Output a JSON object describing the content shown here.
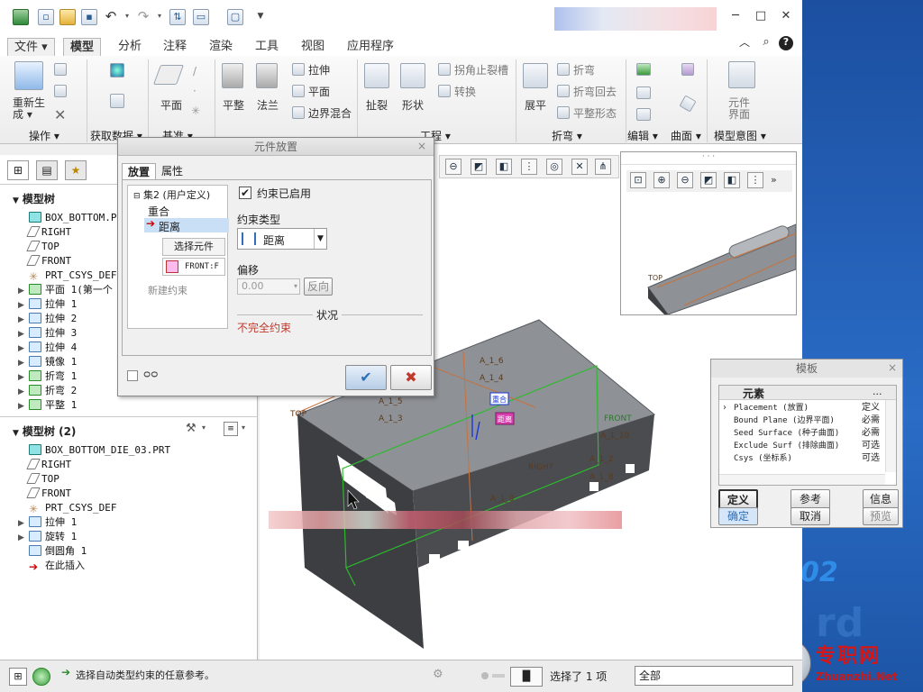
{
  "desktop": {
    "version_text": "02",
    "watermark_text": "rd",
    "site_name": "专职网",
    "site_url": "Zhuanzhi.Net"
  },
  "titlebar": {
    "min": "─",
    "max": "□",
    "close": "✕"
  },
  "ribbon_tabs": [
    "文件 ▾",
    "模型",
    "分析",
    "注释",
    "渲染",
    "工具",
    "视图",
    "应用程序"
  ],
  "ribbon": {
    "regen_label": "重新生成 ▾",
    "buttons": {
      "plane": "平面",
      "flatten": "平整",
      "method": "法兰",
      "extrude": "拉伸",
      "flat": "平面",
      "boundary_blend": "边界混合",
      "rip": "扯裂",
      "form": "形状",
      "corner_relief": "拐角止裂槽",
      "convert": "转换",
      "unbend": "展平",
      "bend": "折弯",
      "bend_back": "折弯回去",
      "flat_pattern": "平整形态",
      "component_interface": "元件界面"
    },
    "groups": [
      "操作 ▾",
      "获取数据 ▾",
      "基准 ▾",
      "工程 ▾",
      "折弯 ▾",
      "编辑 ▾",
      "曲面 ▾",
      "模型意图 ▾"
    ]
  },
  "left_panel": {
    "tree1_title": "模型树",
    "tree1": [
      {
        "icon": "part",
        "label": "BOX_BOTTOM.PRT",
        "toggle": ""
      },
      {
        "icon": "plane",
        "label": "RIGHT",
        "toggle": ""
      },
      {
        "icon": "plane",
        "label": "TOP",
        "toggle": ""
      },
      {
        "icon": "plane",
        "label": "FRONT",
        "toggle": ""
      },
      {
        "icon": "csys",
        "label": "PRT_CSYS_DEF",
        "toggle": ""
      },
      {
        "icon": "green",
        "label": "平面 1(第一个",
        "toggle": "▶"
      },
      {
        "icon": "blue",
        "label": "拉伸 1",
        "toggle": "▶"
      },
      {
        "icon": "blue",
        "label": "拉伸 2",
        "toggle": "▶"
      },
      {
        "icon": "blue",
        "label": "拉伸 3",
        "toggle": "▶"
      },
      {
        "icon": "blue",
        "label": "拉伸 4",
        "toggle": "▶"
      },
      {
        "icon": "blue",
        "label": "镜像 1",
        "toggle": "▶"
      },
      {
        "icon": "green",
        "label": "折弯 1",
        "toggle": "▶"
      },
      {
        "icon": "green",
        "label": "折弯 2",
        "toggle": "▶"
      },
      {
        "icon": "green",
        "label": "平整 1",
        "toggle": "▶"
      }
    ],
    "tree2_title": "模型树 (2)",
    "tree2": [
      {
        "icon": "part",
        "label": "BOX_BOTTOM_DIE_03.PRT",
        "toggle": ""
      },
      {
        "icon": "plane",
        "label": "RIGHT",
        "toggle": ""
      },
      {
        "icon": "plane",
        "label": "TOP",
        "toggle": ""
      },
      {
        "icon": "plane",
        "label": "FRONT",
        "toggle": ""
      },
      {
        "icon": "csys",
        "label": "PRT_CSYS_DEF",
        "toggle": ""
      },
      {
        "icon": "blue",
        "label": "拉伸 1",
        "toggle": "▶"
      },
      {
        "icon": "blue",
        "label": "旋转 1",
        "toggle": "▶"
      },
      {
        "icon": "blue",
        "label": "倒圆角 1",
        "toggle": ""
      },
      {
        "icon": "arrow",
        "label": "在此插入",
        "toggle": ""
      }
    ]
  },
  "dialog": {
    "title": "元件放置",
    "tabs": [
      "放置",
      "属性"
    ],
    "set_label": "集2 (用户定义)",
    "constraint_items": [
      "重合",
      "距离"
    ],
    "select_component": "选择元件",
    "front_ref": "FRONT:F",
    "new_constraint": "新建约束",
    "enabled_label": "约束已启用",
    "type_label": "约束类型",
    "type_value": "距离",
    "offset_label": "偏移",
    "offset_value": "0.00",
    "flip_button": "反向",
    "status_label": "状况",
    "status_value": "不完全约束",
    "ok": "✔",
    "cancel": "✖"
  },
  "template": {
    "title": "模板",
    "col1": "元素",
    "col2": "...",
    "rows": [
      {
        "name": "Placement (放置)",
        "value": "定义"
      },
      {
        "name": "Bound Plane (边界平面)",
        "value": "必需"
      },
      {
        "name": "Seed Surface (种子曲面)",
        "value": "必需"
      },
      {
        "name": "Exclude Surf (排除曲面)",
        "value": "可选"
      },
      {
        "name": "Csys (坐标系)",
        "value": "可选"
      }
    ],
    "buttons": [
      "定义",
      "参考",
      "信息",
      "确定",
      "取消",
      "预览"
    ]
  },
  "model_labels": {
    "top": "TOP",
    "right": "RIGHT",
    "front": "FRONT",
    "a16": "A_1_6",
    "a14": "A_1_4",
    "a15": "A_1_5",
    "a13": "A_1_3",
    "a12": "A_1_2",
    "a18": "A_1_8",
    "a110": "A_1_10",
    "a19": "A_1_9",
    "tag1": "重合",
    "tag2": "距离",
    "sub_top": "TOP"
  },
  "status_bar": {
    "message": "选择自动类型约束的任意参考。",
    "selected": "选择了 1 项",
    "filter": "全部"
  },
  "colors": {
    "accent": "#2f6fb8",
    "warning": "#c0392b",
    "model_gray": "#8c8f94",
    "model_dark": "#3a3c40",
    "green_edge": "#2dbb2d",
    "orange_edge": "#c8723a"
  }
}
